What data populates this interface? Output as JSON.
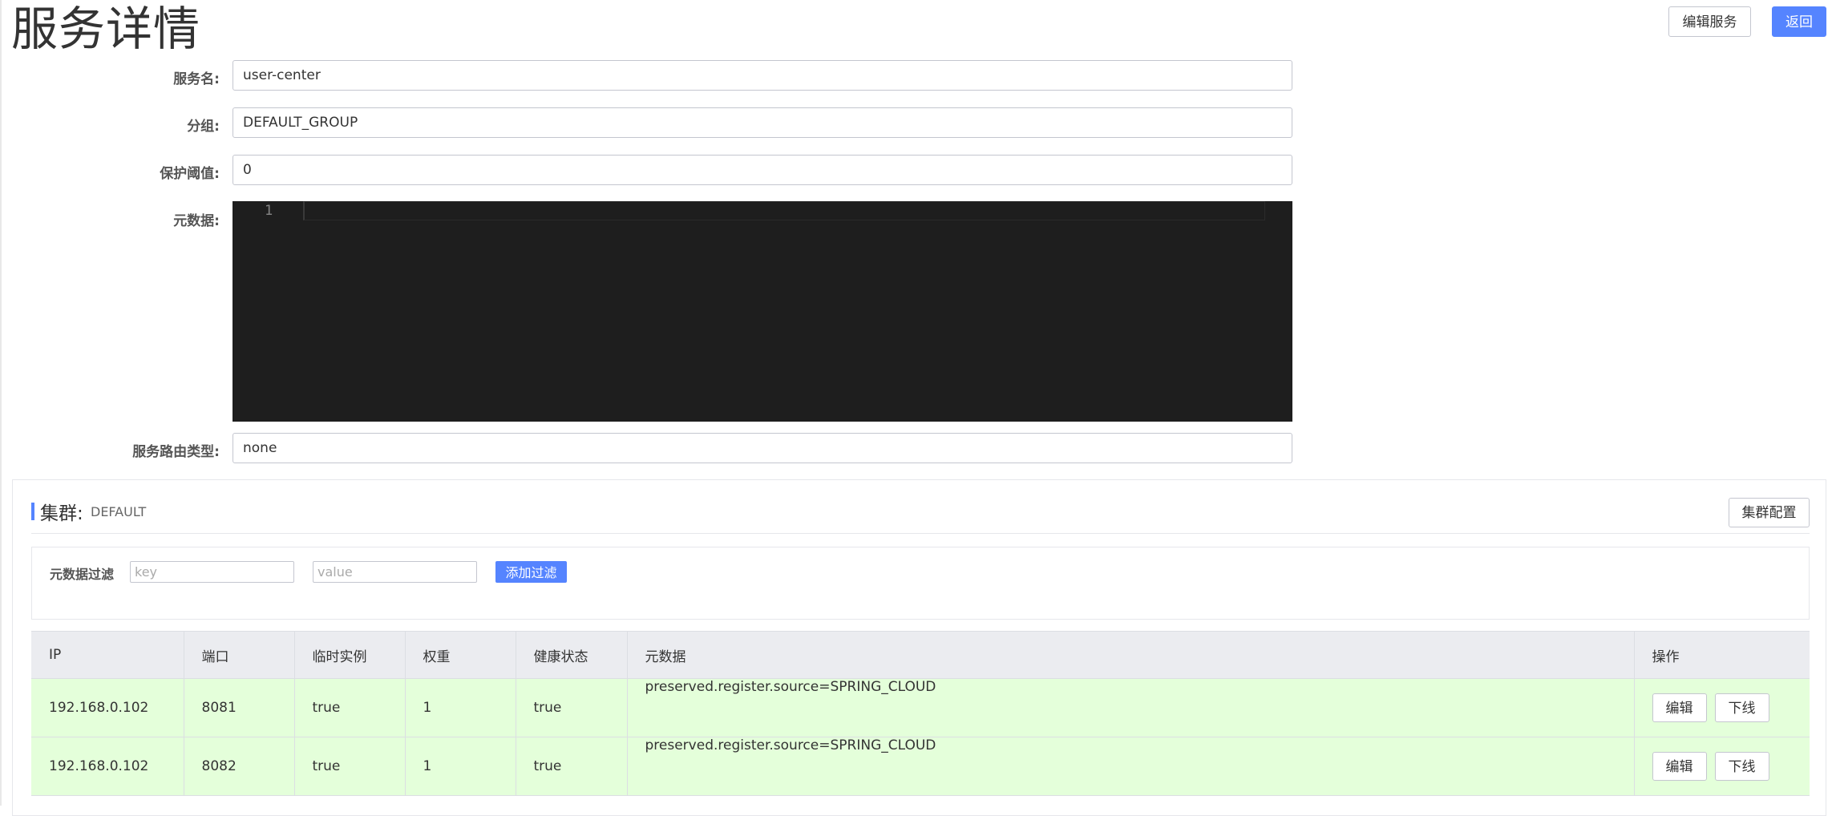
{
  "page": {
    "title": "服务详情",
    "edit_service_label": "编辑服务",
    "back_label": "返回"
  },
  "form": {
    "service_name": {
      "label": "服务名:",
      "value": "user-center"
    },
    "group": {
      "label": "分组:",
      "value": "DEFAULT_GROUP"
    },
    "protect_threshold": {
      "label": "保护阈值:",
      "value": "0"
    },
    "metadata": {
      "label": "元数据:",
      "line_number": "1"
    },
    "selector_type": {
      "label": "服务路由类型:",
      "value": "none"
    }
  },
  "cluster": {
    "title": "集群:",
    "name": "DEFAULT",
    "config_label": "集群配置",
    "filter": {
      "label": "元数据过滤",
      "key_placeholder": "key",
      "value_placeholder": "value",
      "add_label": "添加过滤"
    },
    "table": {
      "headers": [
        "IP",
        "端口",
        "临时实例",
        "权重",
        "健康状态",
        "元数据",
        "操作"
      ],
      "rows": [
        {
          "ip": "192.168.0.102",
          "port": "8081",
          "ephemeral": "true",
          "weight": "1",
          "healthy": "true",
          "metadata": "preserved.register.source=SPRING_CLOUD",
          "edit_label": "编辑",
          "offline_label": "下线"
        },
        {
          "ip": "192.168.0.102",
          "port": "8082",
          "ephemeral": "true",
          "weight": "1",
          "healthy": "true",
          "metadata": "preserved.register.source=SPRING_CLOUD",
          "edit_label": "编辑",
          "offline_label": "下线"
        }
      ]
    }
  },
  "colors": {
    "primary": "#5584ff",
    "editor_bg": "#1e1e1e",
    "healthy_row": "#e4ffda",
    "table_header": "#ebecf0"
  }
}
